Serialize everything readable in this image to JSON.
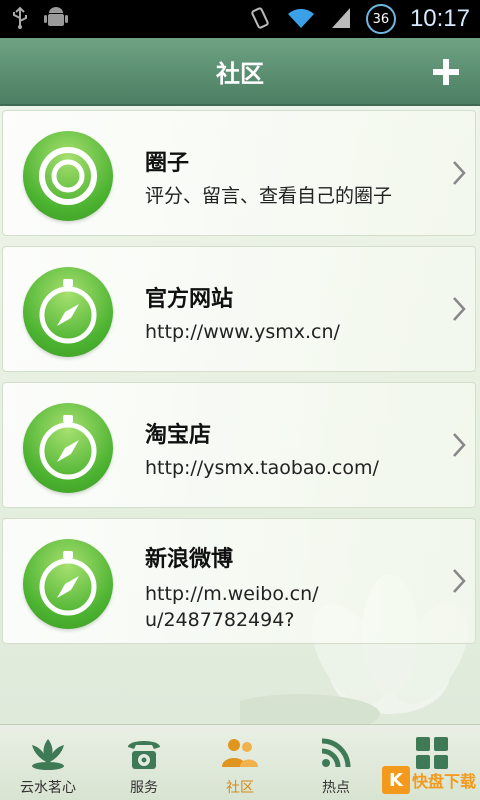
{
  "status_bar": {
    "left_icons": [
      "usb-icon",
      "android-debug-icon"
    ],
    "right_icons": [
      "vibrate-icon",
      "wifi-icon",
      "signal-icon"
    ],
    "badge": "36",
    "time": "10:17"
  },
  "header": {
    "title": "社区",
    "add_label": "+"
  },
  "cards": [
    {
      "title": "圈子",
      "subtitle": "评分、留言、查看自己的圈子",
      "icon": "target-icon"
    },
    {
      "title": "官方网站",
      "subtitle": "http://www.ysmx.cn/",
      "icon": "compass-icon"
    },
    {
      "title": "淘宝店",
      "subtitle": "http://ysmx.taobao.com/",
      "icon": "compass-icon"
    },
    {
      "title": "新浪微博",
      "subtitle": "http://m.weibo.cn/\nu/2487782494?",
      "icon": "compass-icon"
    }
  ],
  "tabs": [
    {
      "label": "云水茗心",
      "icon": "lotus-icon"
    },
    {
      "label": "服务",
      "icon": "phone-icon"
    },
    {
      "label": "社区",
      "icon": "community-icon",
      "active": true
    },
    {
      "label": "热点",
      "icon": "rss-icon"
    },
    {
      "label": "",
      "icon": "grid-icon"
    }
  ],
  "watermark": {
    "logo": "K",
    "text": "快盘下载"
  },
  "colors": {
    "header": "#5a8e70",
    "icon_green": "#4cb331",
    "active_tab": "#d38a1a"
  }
}
